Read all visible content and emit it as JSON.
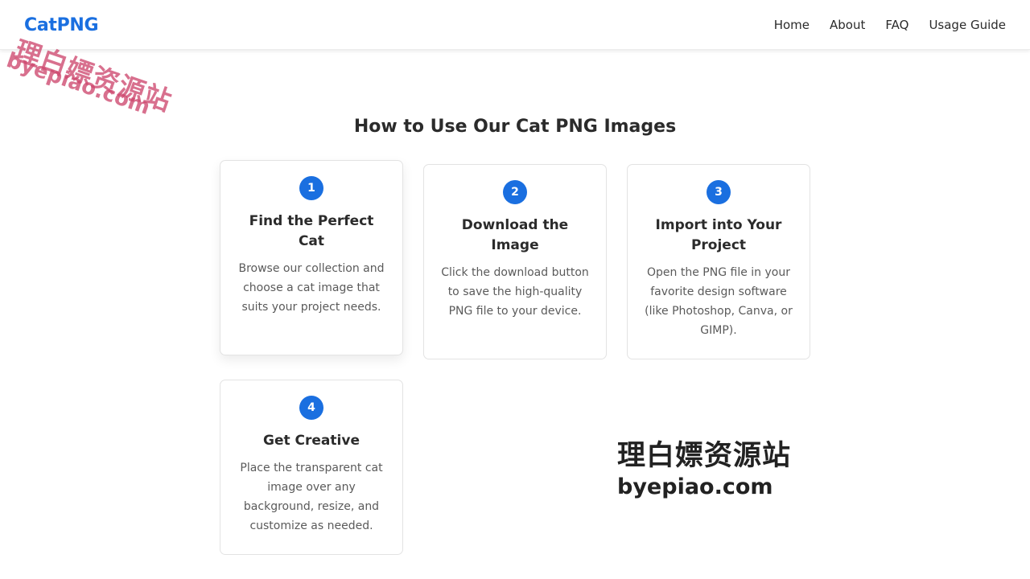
{
  "nav": {
    "brand": "CatPNG",
    "links": [
      "Home",
      "About",
      "FAQ",
      "Usage Guide"
    ]
  },
  "section": {
    "title": "How to Use Our Cat PNG Images"
  },
  "steps": [
    {
      "number": "1",
      "title": "Find the Perfect Cat",
      "text": "Browse our collection and choose a cat image that suits your project needs."
    },
    {
      "number": "2",
      "title": "Download the Image",
      "text": "Click the download button to save the high-quality PNG file to your device."
    },
    {
      "number": "3",
      "title": "Import into Your Project",
      "text": "Open the PNG file in your favorite design software (like Photoshop, Canva, or GIMP)."
    },
    {
      "number": "4",
      "title": "Get Creative",
      "text": "Place the transparent cat image over any background, resize, and customize as needed."
    }
  ],
  "watermark": {
    "cn": "理白嫖资源站",
    "en": "byepiao.com"
  },
  "colors": {
    "accent": "#1a6fe0",
    "watermark_pink": "#cd486e"
  }
}
